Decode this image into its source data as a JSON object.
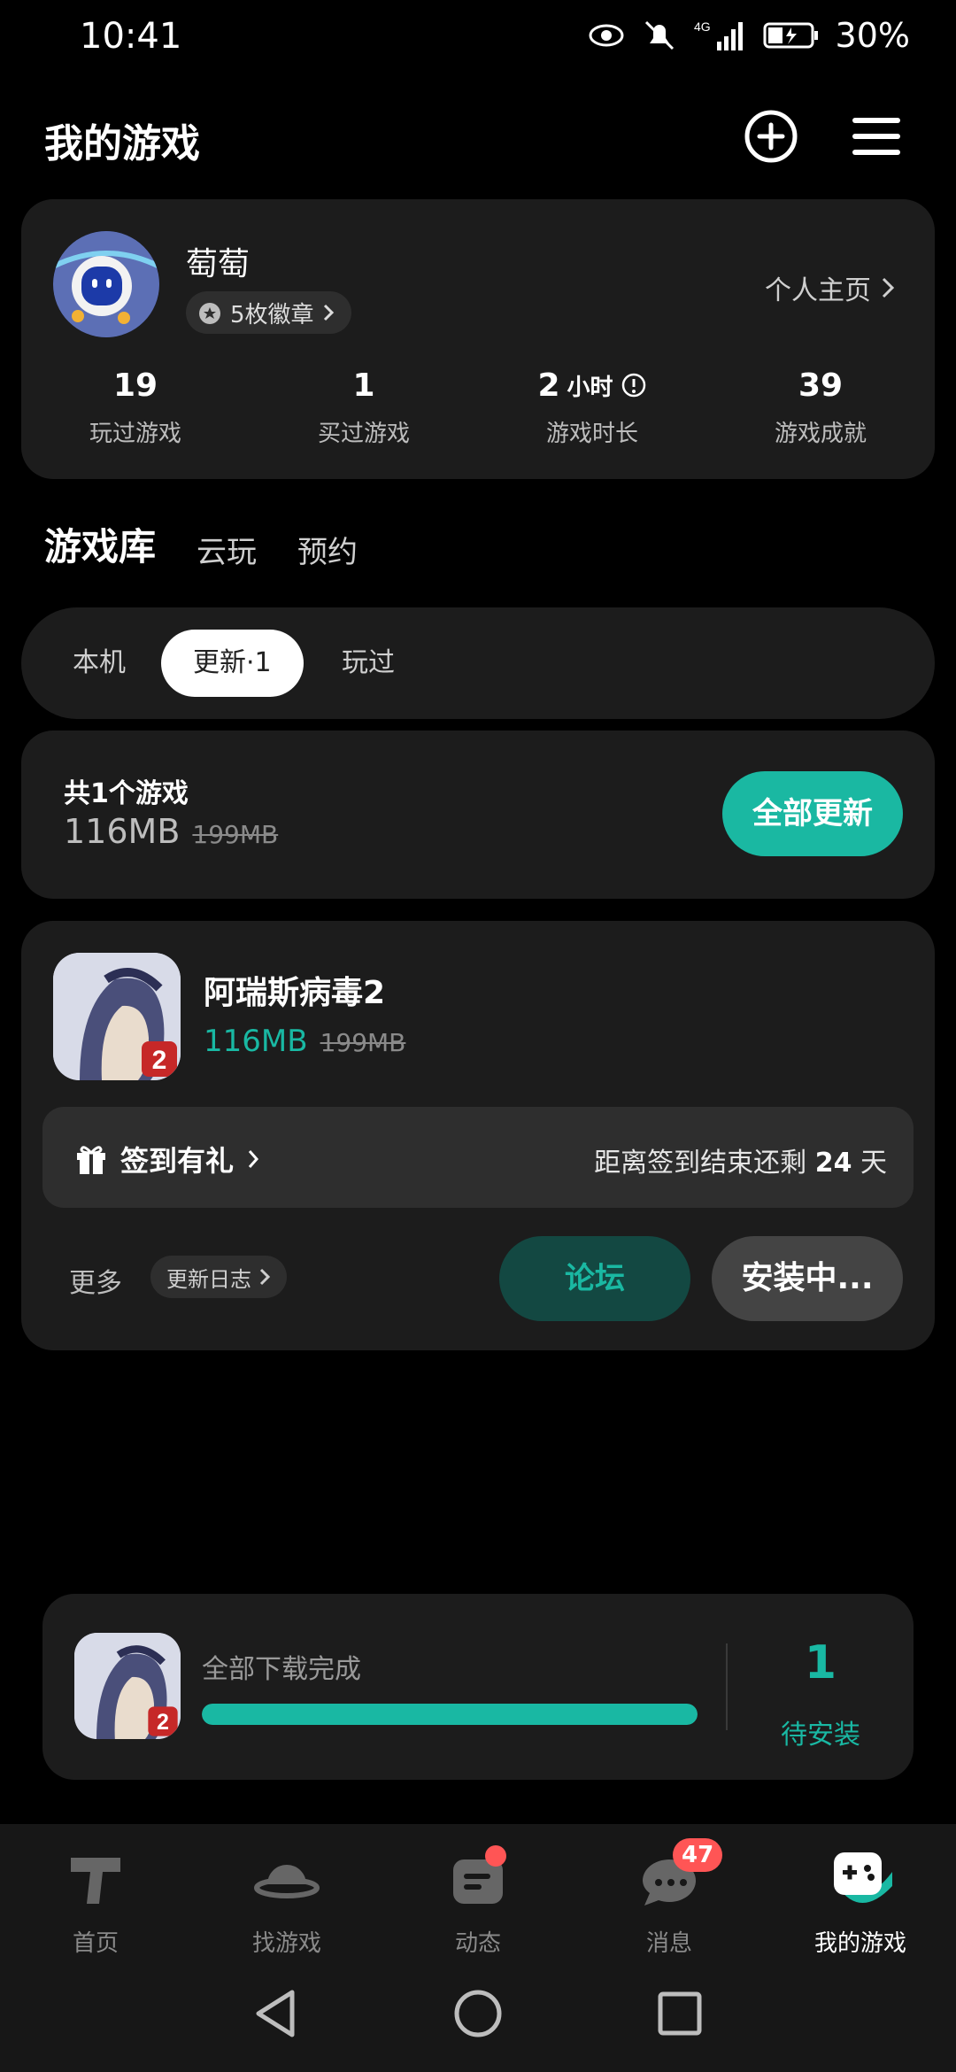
{
  "status_bar": {
    "time": "10:41",
    "network": "4G",
    "battery": "30%"
  },
  "header": {
    "title": "我的游戏"
  },
  "profile": {
    "username": "萄萄",
    "badges_label": "5枚徽章",
    "homepage_label": "个人主页",
    "stats": [
      {
        "value": "19",
        "unit": "",
        "label": "玩过游戏"
      },
      {
        "value": "1",
        "unit": "",
        "label": "买过游戏"
      },
      {
        "value": "2",
        "unit": "小时",
        "label": "游戏时长"
      },
      {
        "value": "39",
        "unit": "",
        "label": "游戏成就"
      }
    ]
  },
  "section_tabs": [
    "游戏库",
    "云玩",
    "预约"
  ],
  "filters": [
    "本机",
    "更新·1",
    "玩过"
  ],
  "summary": {
    "count_label": "共1个游戏",
    "size": "116MB",
    "original_size": "199MB",
    "update_all_label": "全部更新"
  },
  "game": {
    "name": "阿瑞斯病毒2",
    "size": "116MB",
    "original_size": "199MB",
    "signin_label": "签到有礼",
    "signin_remaining_prefix": "距离签到结束还剩 ",
    "signin_remaining_days": "24",
    "signin_remaining_suffix": " 天",
    "more_label": "更多",
    "changelog_label": "更新日志",
    "forum_label": "论坛",
    "install_label": "安装中..."
  },
  "download": {
    "status": "全部下载完成",
    "progress": 1.0,
    "pending_count": "1",
    "pending_label": "待安装"
  },
  "bottom_nav": [
    {
      "label": "首页",
      "icon": "home-icon"
    },
    {
      "label": "找游戏",
      "icon": "planet-icon"
    },
    {
      "label": "动态",
      "icon": "feed-icon",
      "dot": true
    },
    {
      "label": "消息",
      "icon": "chat-icon",
      "badge": "47"
    },
    {
      "label": "我的游戏",
      "icon": "gamepad-icon",
      "active": true
    }
  ],
  "colors": {
    "accent": "#19b8a3",
    "card": "#1c1c1c",
    "badge": "#ff5555"
  }
}
